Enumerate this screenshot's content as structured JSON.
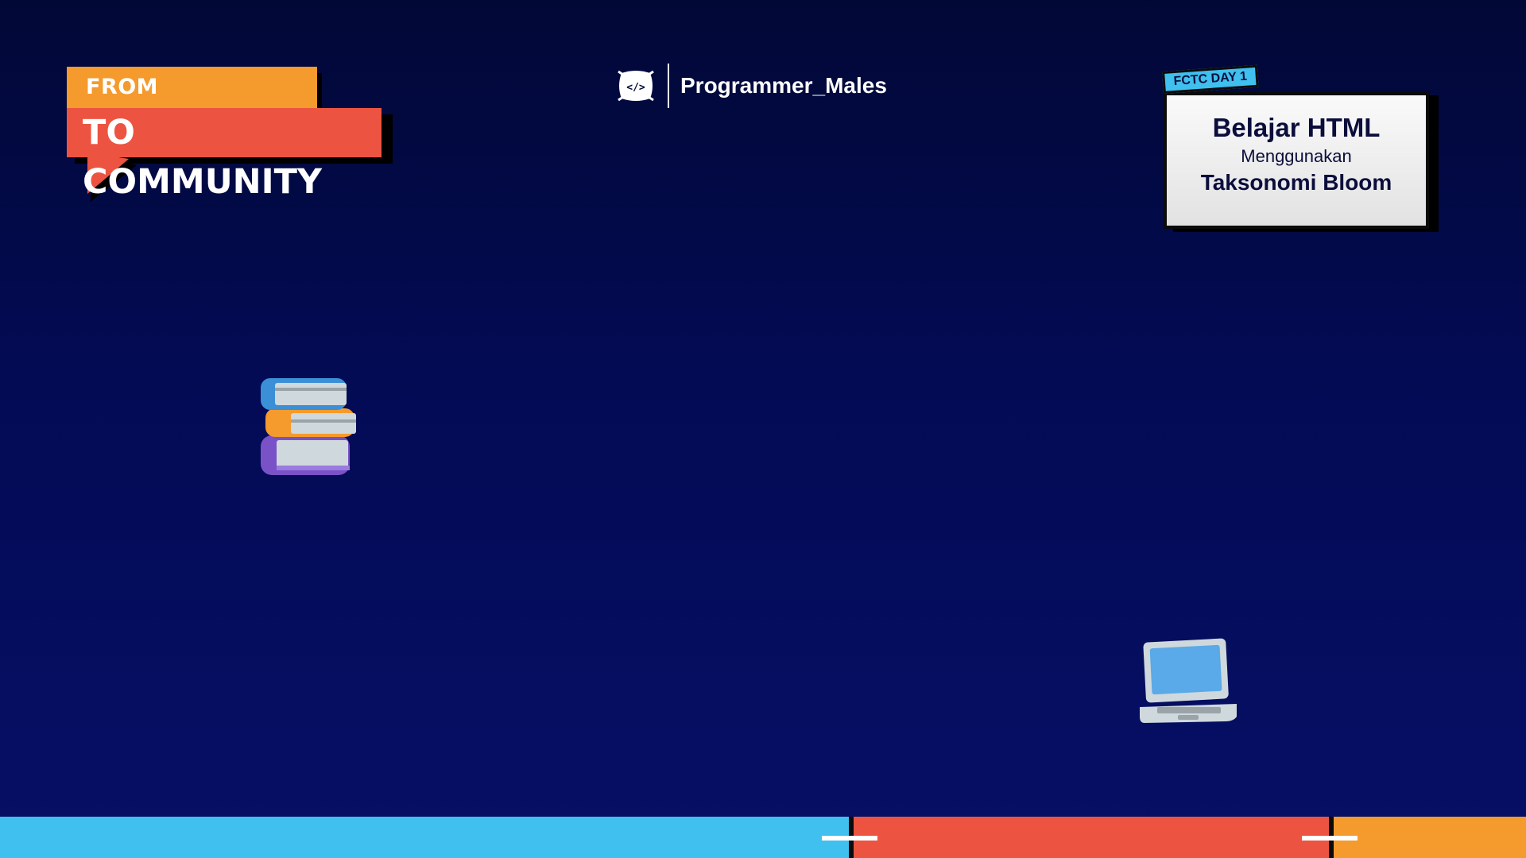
{
  "colors": {
    "background_top": "#020836",
    "background_bottom": "#060f66",
    "orange": "#f59a2c",
    "red": "#ec5441",
    "blue": "#3fc0ef",
    "navy_text": "#0b0e3b"
  },
  "banner": {
    "line1": "From Community",
    "line2": "To Community"
  },
  "brand": {
    "icon": "code-pillow-icon",
    "name": "Programmer_Males"
  },
  "card": {
    "tag": "FCTC DAY 1",
    "title": "Belajar HTML",
    "subtitle": "Menggunakan",
    "subtitle2": "Taksonomi Bloom"
  },
  "illustrations": [
    "books-icon",
    "laptop-icon"
  ]
}
